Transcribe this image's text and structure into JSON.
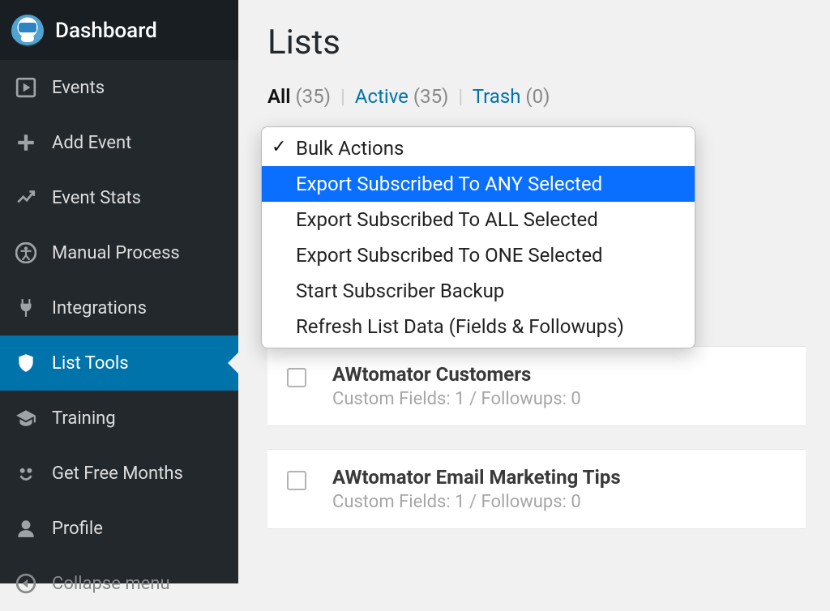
{
  "sidebar": {
    "items": [
      {
        "label": "Dashboard",
        "name": "sidebar-item-dashboard",
        "icon": "avatar-logo"
      },
      {
        "label": "Events",
        "name": "sidebar-item-events",
        "icon": "play-icon"
      },
      {
        "label": "Add Event",
        "name": "sidebar-item-add-event",
        "icon": "plus-icon"
      },
      {
        "label": "Event Stats",
        "name": "sidebar-item-event-stats",
        "icon": "stats-icon"
      },
      {
        "label": "Manual Process",
        "name": "sidebar-item-manual-process",
        "icon": "accessibility-icon"
      },
      {
        "label": "Integrations",
        "name": "sidebar-item-integrations",
        "icon": "plug-icon"
      },
      {
        "label": "List Tools",
        "name": "sidebar-item-list-tools",
        "icon": "shield-icon",
        "active": true
      },
      {
        "label": "Training",
        "name": "sidebar-item-training",
        "icon": "graduation-icon"
      },
      {
        "label": "Get Free Months",
        "name": "sidebar-item-get-free-months",
        "icon": "smile-icon"
      },
      {
        "label": "Profile",
        "name": "sidebar-item-profile",
        "icon": "user-icon"
      },
      {
        "label": "Collapse menu",
        "name": "sidebar-item-collapse",
        "icon": "collapse-icon"
      }
    ]
  },
  "page": {
    "title": "Lists"
  },
  "filters": {
    "all": {
      "label": "All",
      "count": "(35)"
    },
    "active": {
      "label": "Active",
      "count": "(35)"
    },
    "trash": {
      "label": "Trash",
      "count": "(0)"
    },
    "sep": "|"
  },
  "bulk_actions": {
    "options": [
      {
        "label": "Bulk Actions",
        "checked": true
      },
      {
        "label": "Export Subscribed To ANY Selected",
        "highlighted": true
      },
      {
        "label": "Export Subscribed To ALL Selected"
      },
      {
        "label": "Export Subscribed To ONE Selected"
      },
      {
        "label": "Start Subscriber Backup"
      },
      {
        "label": "Refresh List Data (Fields & Followups)"
      }
    ]
  },
  "lists": [
    {
      "title": "AWtomator Customers",
      "meta": "Custom Fields: 1 / Followups: 0"
    },
    {
      "title": "AWtomator Email Marketing Tips",
      "meta": "Custom Fields: 1 / Followups: 0"
    }
  ]
}
